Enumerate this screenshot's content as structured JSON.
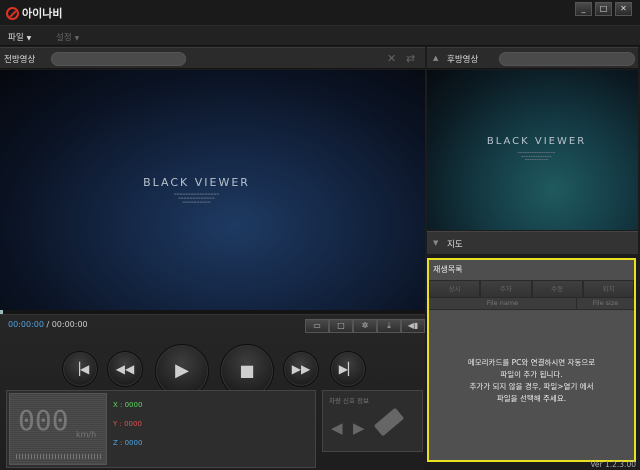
{
  "app": {
    "title": "아이나비"
  },
  "window_controls": {
    "minimize": "_",
    "maximize": "□",
    "close": "✕"
  },
  "menu": {
    "file": "파일",
    "settings": "설정"
  },
  "front_panel": {
    "title": "전방영상",
    "video_text": "BLACK VIEWER"
  },
  "rear_panel": {
    "title": "후방영상",
    "video_text": "BLACK VIEWER"
  },
  "player": {
    "current_time": "00:00:00",
    "separator": " / ",
    "total_time": "00:00:00",
    "progress": 0
  },
  "sensor": {
    "speed": "000",
    "speed_unit": "km/h",
    "x_label": "X : 0000",
    "y_label": "Y : 0000",
    "z_label": "Z : 0000"
  },
  "vehicle_signal": {
    "title": "차량 신호 정보"
  },
  "map": {
    "title": "지도"
  },
  "playlist": {
    "title": "재생목록",
    "tabs": [
      "상시",
      "주차",
      "수동",
      "위치"
    ],
    "columns": {
      "file_name": "File name",
      "file_size": "File size"
    },
    "empty_message": [
      "메모리카드를 PC와 연결하시면 자동으로",
      "파일이 추가 됩니다.",
      "추가가 되지 않을 경우, 파일>열기 에서",
      "파일을 선택해 주세요."
    ]
  },
  "version": "Ver 1.2.3.00",
  "colors": {
    "highlight": "#e8e020",
    "time_current": "#4fa3e0",
    "axis_x": "#5fd85f",
    "axis_y": "#e05050",
    "axis_z": "#4fa3e0",
    "logo": "#dd3322"
  }
}
